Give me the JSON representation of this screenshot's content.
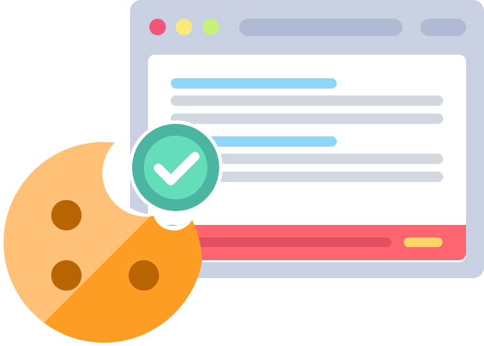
{
  "illustration": {
    "subject": "cookie-consent",
    "colors": {
      "window_frame": "#C9D1E3",
      "window_bar_shapes": "#B0BAD3",
      "content_panel": "#FFFFFF",
      "dot_red": "#F2557A",
      "dot_yellow": "#FCE97B",
      "dot_green": "#C6F27A",
      "heading_line": "#8ED6FB",
      "text_line": "#D3D7DE",
      "banner": "#FF656E",
      "banner_inner_line": "#E24F5E",
      "banner_button": "#FCD56A",
      "check_ring": "#4AB5A0",
      "check_fill": "#66DDBA",
      "check_mark": "#FFFFFF",
      "cookie_light": "#FEC177",
      "cookie_dark": "#FE9D24",
      "chip": "#B86402"
    },
    "icons": [
      "browser-window-icon",
      "check-badge-icon",
      "cookie-icon"
    ]
  }
}
